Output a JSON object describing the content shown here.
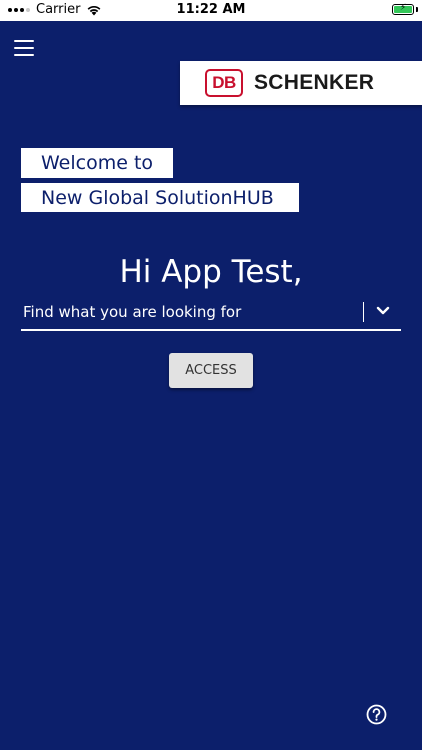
{
  "status_bar": {
    "carrier": "Carrier",
    "time": "11:22 AM",
    "signal_icon": "signal-dots-icon",
    "wifi_icon": "wifi-icon",
    "battery_icon": "battery-charging-icon",
    "battery_color": "#34c759"
  },
  "header": {
    "menu_icon": "hamburger-menu-icon",
    "logo": {
      "mark": "DB",
      "name": "SCHENKER",
      "mark_color": "#c8102e"
    }
  },
  "welcome": {
    "line1": "Welcome to",
    "line2": "New Global SolutionHUB"
  },
  "greeting": "Hi App Test,",
  "search_select": {
    "value": "Find what you are looking for",
    "icon": "chevron-down-icon"
  },
  "access_button": {
    "label": "ACCESS"
  },
  "help": {
    "icon": "question-circle-icon"
  },
  "colors": {
    "background": "#0c1f6b",
    "panel": "#ffffff",
    "button": "#e2e2e2"
  }
}
